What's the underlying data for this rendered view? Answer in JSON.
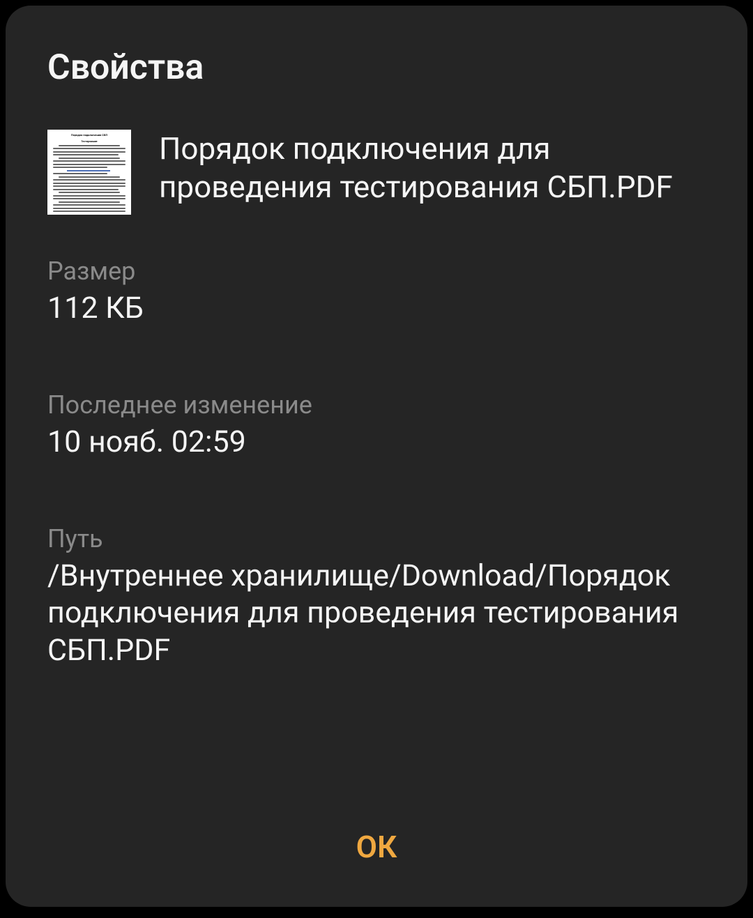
{
  "dialog": {
    "title": "Свойства",
    "file_name": "Порядок подключения для проведения тестирования СБП.PDF",
    "size_label": "Размер",
    "size_value": "112 КБ",
    "modified_label": "Последнее изменение",
    "modified_value": "10 нояб. 02:59",
    "path_label": "Путь",
    "path_value": "/Внутреннее хранилище/Download/Порядок подключения для проведения тестирования СБП.PDF",
    "ok_button": "ОК"
  }
}
